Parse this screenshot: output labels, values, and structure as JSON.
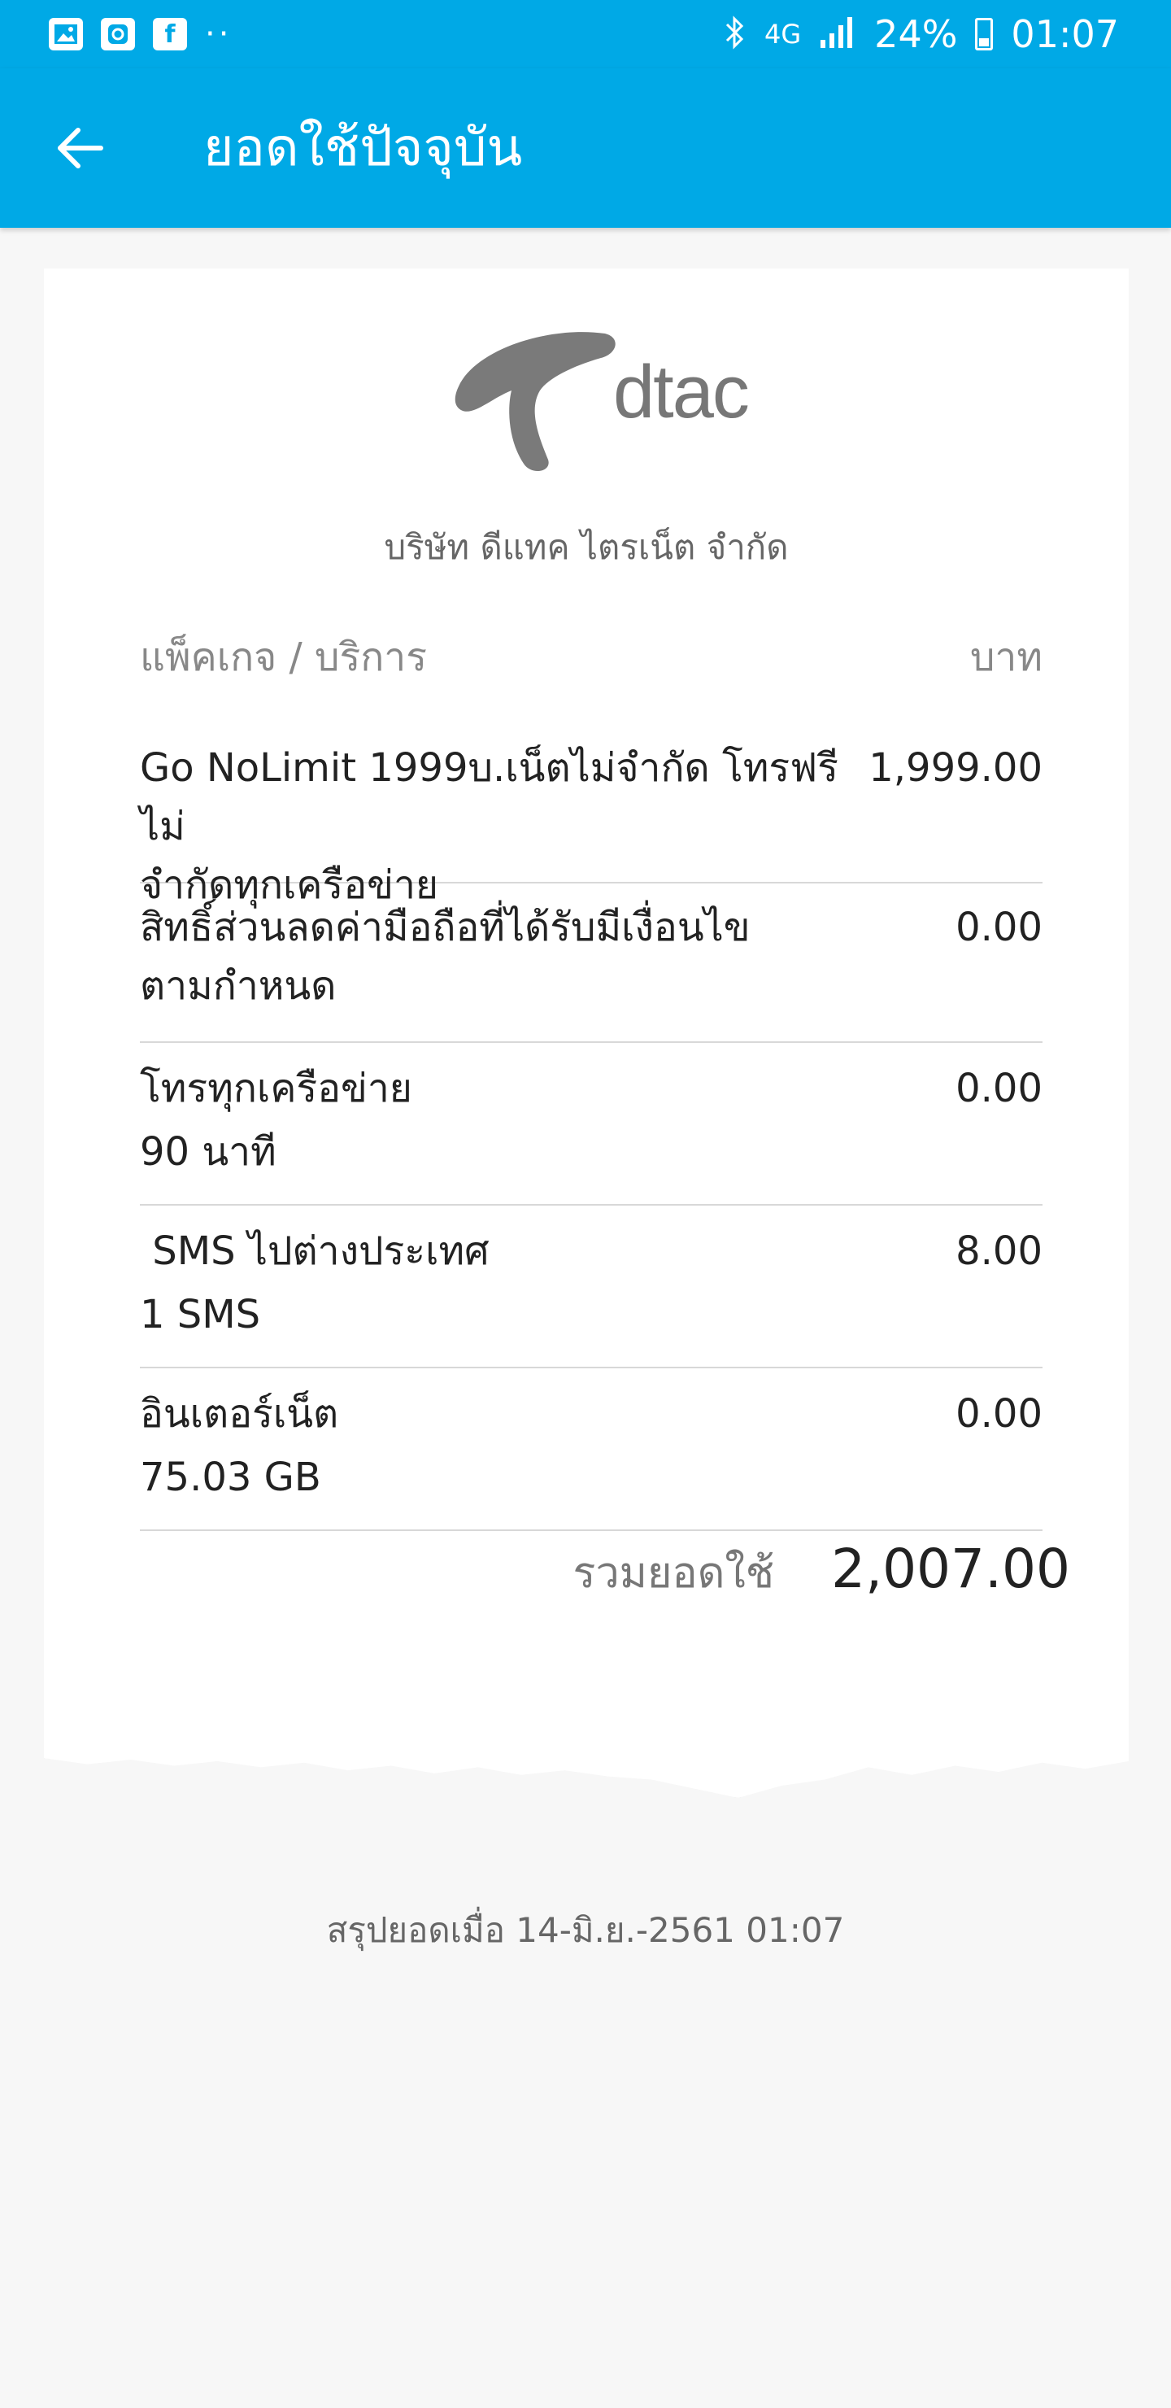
{
  "status_bar": {
    "left_icons": [
      "gallery-icon",
      "instagram-icon",
      "facebook-icon"
    ],
    "dots": "··",
    "network": "4G",
    "battery": "24%",
    "time": "01:07"
  },
  "app_bar": {
    "title": "ยอดใช้ปัจจุบัน"
  },
  "receipt": {
    "logo_text": "dtac",
    "company": "บริษัท ดีแทค ไตรเน็ต จำกัด",
    "header": {
      "package": "แพ็คเกจ / บริการ",
      "currency": "บาท"
    },
    "items": [
      {
        "line1": "Go NoLimit 1999บ.เน็ตไม่จำกัด โทรฟรีไม่",
        "line2": "จำกัดทุกเครือข่าย",
        "amount": "1,999.00"
      },
      {
        "line1": "สิทธิ์ส่วนลดค่ามือถือที่ได้รับมีเงื่อนไข",
        "line2": "ตามกำหนด",
        "amount": "0.00"
      },
      {
        "line1": "โทรทุกเครือข่าย",
        "line2": "90  นาที",
        "amount": "0.00"
      },
      {
        "line1": " SMS ไปต่างประเทศ",
        "line2": "1  SMS",
        "amount": "8.00"
      },
      {
        "line1": "อินเตอร์เน็ต",
        "line2": "75.03  GB",
        "amount": "0.00"
      }
    ],
    "total_label": "รวมยอดใช้",
    "total_value": "2,007.00"
  },
  "summary": "สรุปยอดเมื่อ  14-มิ.ย.-2561 01:07",
  "colors": {
    "primary": "#00a9e6",
    "logo_gray": "#777777"
  }
}
